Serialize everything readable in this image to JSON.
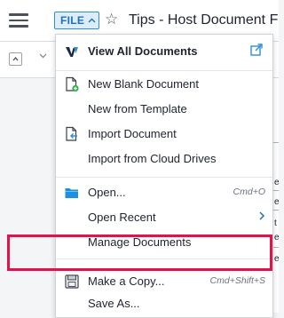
{
  "topbar": {
    "menu_icon": "hamburger-icon",
    "file_label": "FILE",
    "file_chevron": "^",
    "star_icon": "☆",
    "doc_title": "Tips - Host Document For"
  },
  "background": {
    "right_chars": [
      "e",
      "e",
      "t",
      "e",
      "e"
    ]
  },
  "file_menu": {
    "items": [
      {
        "label": "View All Documents",
        "icon": "wordpad-logo-icon",
        "trailing_icon": "open-external-icon"
      },
      {
        "label": "New Blank Document",
        "icon": "new-document-icon"
      },
      {
        "label": "New from Template"
      },
      {
        "label": "Import Document",
        "icon": "import-document-icon"
      },
      {
        "label": "Import from Cloud Drives"
      },
      {
        "label": "Open...",
        "icon": "folder-icon",
        "shortcut": "Cmd+O"
      },
      {
        "label": "Open Recent",
        "submenu": "›"
      },
      {
        "label": "Manage Documents"
      },
      {
        "label": "Make a Copy...",
        "icon": "copy-document-icon",
        "shortcut": "Cmd+Shift+S"
      },
      {
        "label": "Save As..."
      }
    ]
  },
  "colors": {
    "accent": "#1a73c2",
    "highlight": "#e0134a",
    "folder": "#1e8fe0"
  }
}
